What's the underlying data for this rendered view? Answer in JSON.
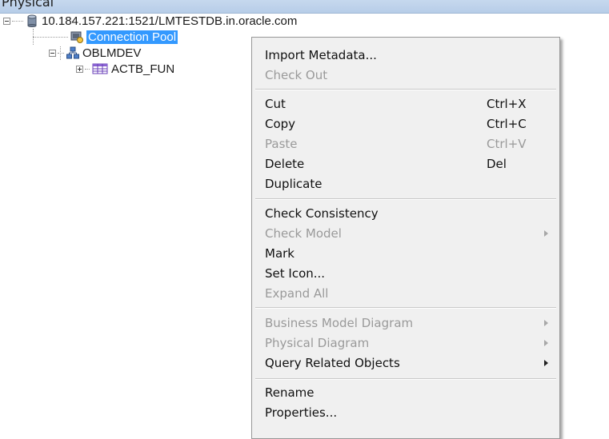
{
  "header": {
    "title": "Physical"
  },
  "tree": {
    "db_label": "10.184.157.221:1521/LMTESTDB.in.oracle.com",
    "pool_label": "Connection Pool",
    "schema_label": "OBLMDEV",
    "table_label": "ACTB_FUN"
  },
  "menu": {
    "items": [
      {
        "label": "Import Metadata...",
        "shortcut": "",
        "enabled": true
      },
      {
        "label": "Check Out",
        "shortcut": "",
        "enabled": false
      },
      {
        "label": "Cut",
        "shortcut": "Ctrl+X",
        "enabled": true
      },
      {
        "label": "Copy",
        "shortcut": "Ctrl+C",
        "enabled": true
      },
      {
        "label": "Paste",
        "shortcut": "Ctrl+V",
        "enabled": false
      },
      {
        "label": "Delete",
        "shortcut": "Del",
        "enabled": true
      },
      {
        "label": "Duplicate",
        "shortcut": "",
        "enabled": true
      },
      {
        "label": "Check Consistency",
        "shortcut": "",
        "enabled": true
      },
      {
        "label": "Check Model",
        "shortcut": "",
        "enabled": false,
        "submenu": true
      },
      {
        "label": "Mark",
        "shortcut": "",
        "enabled": true
      },
      {
        "label": "Set Icon...",
        "shortcut": "",
        "enabled": true
      },
      {
        "label": "Expand All",
        "shortcut": "",
        "enabled": false
      },
      {
        "label": "Business Model Diagram",
        "shortcut": "",
        "enabled": false,
        "submenu": true
      },
      {
        "label": "Physical Diagram",
        "shortcut": "",
        "enabled": false,
        "submenu": true
      },
      {
        "label": "Query Related Objects",
        "shortcut": "",
        "enabled": true,
        "submenu": true
      },
      {
        "label": "Rename",
        "shortcut": "",
        "enabled": true
      },
      {
        "label": "Properties...",
        "shortcut": "",
        "enabled": true
      }
    ]
  },
  "colors": {
    "selection": "#3399ff",
    "menu_bg": "#f0f0f0",
    "disabled_text": "#9a9a9a"
  }
}
